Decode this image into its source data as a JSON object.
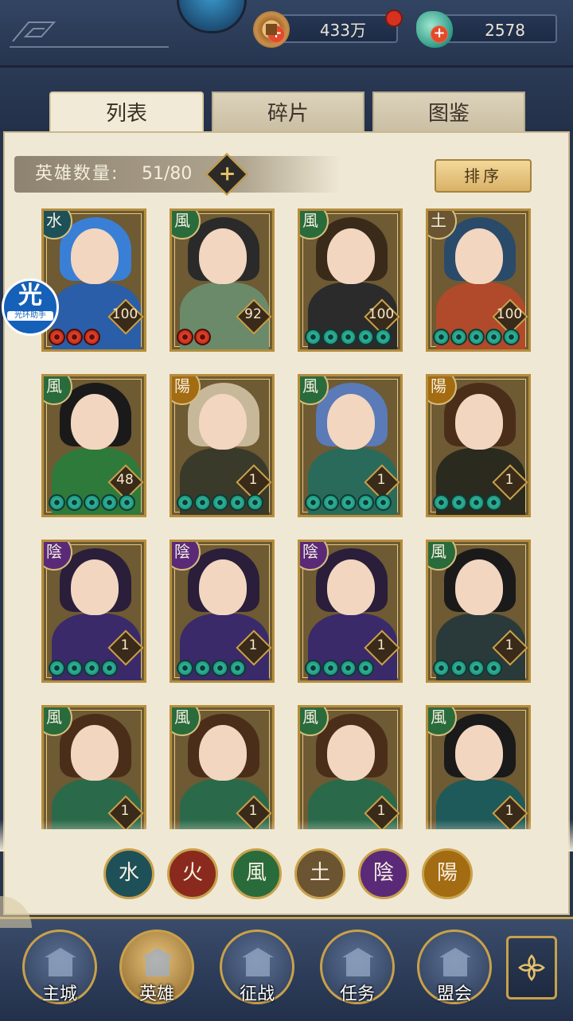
{
  "resources": {
    "coin": {
      "value": "433万",
      "icon": "copper-coin-icon"
    },
    "jade": {
      "value": "2578",
      "icon": "jade-icon"
    }
  },
  "tabs": [
    {
      "label": "列表",
      "active": true
    },
    {
      "label": "碎片",
      "active": false
    },
    {
      "label": "图鉴",
      "active": false
    }
  ],
  "hero_count": {
    "label": "英雄数量:",
    "value": "51/80"
  },
  "sort_label": "排序",
  "helper": {
    "glyph": "光",
    "text": "光环助手"
  },
  "heroes": [
    {
      "element": "水",
      "elem_class": "water",
      "level": "100",
      "stars": 3,
      "star_color": "red",
      "hair": "#3a7fd6",
      "body": "#2b5ea8"
    },
    {
      "element": "風",
      "elem_class": "wind",
      "level": "92",
      "stars": 2,
      "star_color": "red",
      "hair": "#2a2a2a",
      "body": "#6a8a6a"
    },
    {
      "element": "風",
      "elem_class": "wind",
      "level": "100",
      "stars": 5,
      "star_color": "green",
      "hair": "#3a2a1a",
      "body": "#2b2b2b"
    },
    {
      "element": "土",
      "elem_class": "earth",
      "level": "100",
      "stars": 5,
      "star_color": "green",
      "hair": "#2a4a6a",
      "body": "#b04a2a"
    },
    {
      "element": "風",
      "elem_class": "wind",
      "level": "48",
      "stars": 5,
      "star_color": "green",
      "hair": "#1a1a1a",
      "body": "#2e7a3a"
    },
    {
      "element": "陽",
      "elem_class": "yang",
      "level": "1",
      "stars": 5,
      "star_color": "green",
      "hair": "#c8b89a",
      "body": "#3a3a2a"
    },
    {
      "element": "風",
      "elem_class": "wind",
      "level": "1",
      "stars": 5,
      "star_color": "green",
      "hair": "#5a7ab8",
      "body": "#2a6a5a"
    },
    {
      "element": "陽",
      "elem_class": "yang",
      "level": "1",
      "stars": 4,
      "star_color": "green",
      "hair": "#4a2e1a",
      "body": "#2a2a1e"
    },
    {
      "element": "陰",
      "elem_class": "yin",
      "level": "1",
      "stars": 4,
      "star_color": "green",
      "hair": "#2a1e3a",
      "body": "#3a2a6a"
    },
    {
      "element": "陰",
      "elem_class": "yin",
      "level": "1",
      "stars": 4,
      "star_color": "green",
      "hair": "#2a1e3a",
      "body": "#3a2a6a"
    },
    {
      "element": "陰",
      "elem_class": "yin",
      "level": "1",
      "stars": 4,
      "star_color": "green",
      "hair": "#2a1e3a",
      "body": "#3a2a6a"
    },
    {
      "element": "風",
      "elem_class": "wind",
      "level": "1",
      "stars": 4,
      "star_color": "green",
      "hair": "#1a1a1a",
      "body": "#2a3a3a"
    },
    {
      "element": "風",
      "elem_class": "wind",
      "level": "1",
      "stars": 0,
      "star_color": "green",
      "hair": "#4a2e1a",
      "body": "#2a6a4a"
    },
    {
      "element": "風",
      "elem_class": "wind",
      "level": "1",
      "stars": 0,
      "star_color": "green",
      "hair": "#4a2e1a",
      "body": "#2a6a4a"
    },
    {
      "element": "風",
      "elem_class": "wind",
      "level": "1",
      "stars": 0,
      "star_color": "green",
      "hair": "#4a2e1a",
      "body": "#2a6a4a"
    },
    {
      "element": "風",
      "elem_class": "wind",
      "level": "1",
      "stars": 0,
      "star_color": "green",
      "hair": "#1a1a1a",
      "body": "#1e5a5a"
    }
  ],
  "filters": [
    {
      "glyph": "水",
      "elem_class": "water",
      "name": "filter-water"
    },
    {
      "glyph": "火",
      "elem_class": "fire",
      "name": "filter-fire"
    },
    {
      "glyph": "風",
      "elem_class": "wind",
      "name": "filter-wind"
    },
    {
      "glyph": "土",
      "elem_class": "earth",
      "name": "filter-earth"
    },
    {
      "glyph": "陰",
      "elem_class": "yin",
      "name": "filter-yin"
    },
    {
      "glyph": "陽",
      "elem_class": "yang",
      "name": "filter-yang"
    }
  ],
  "nav": [
    {
      "label": "主城",
      "icon": "palace-icon",
      "active": false
    },
    {
      "label": "英雄",
      "icon": "hero-icon",
      "active": true
    },
    {
      "label": "征战",
      "icon": "battle-icon",
      "active": false
    },
    {
      "label": "任务",
      "icon": "task-icon",
      "active": false
    },
    {
      "label": "盟会",
      "icon": "guild-icon",
      "active": false
    }
  ],
  "colors": {
    "accent_gold": "#c9a14a",
    "panel_bg": "#efe8d4",
    "nav_bg": "#22304a"
  }
}
